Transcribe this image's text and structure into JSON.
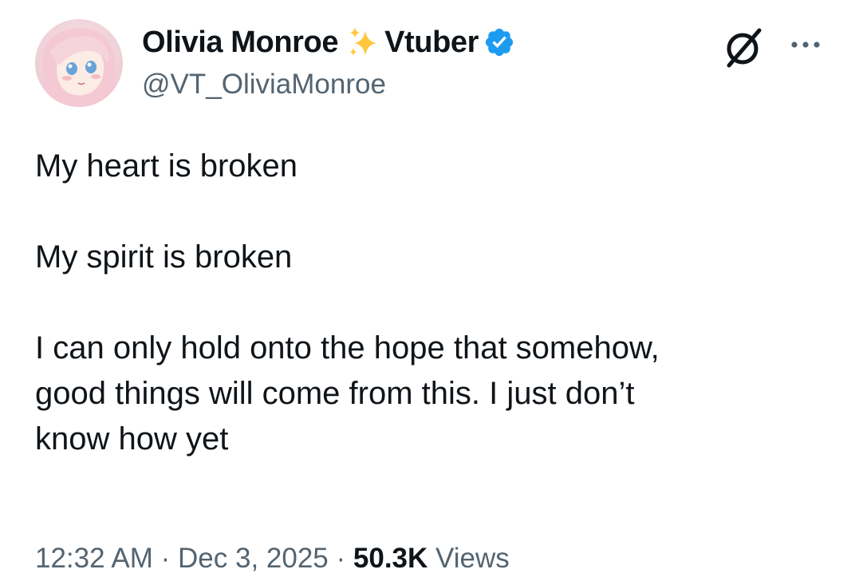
{
  "author": {
    "display_name": "Olivia Monroe",
    "name_emoji": "sparkles-icon",
    "name_suffix": "Vtuber",
    "verified": true,
    "handle": "@VT_OliviaMonroe"
  },
  "tweet": {
    "paragraphs": [
      [
        "My heart is broken"
      ],
      [
        "My spirit is broken"
      ],
      [
        "I can only hold onto the hope that somehow,",
        "good things will come from this. I just don’t",
        "know how yet"
      ]
    ]
  },
  "meta": {
    "time": "12:32 AM",
    "separator": "·",
    "date": "Dec 3, 2025",
    "views_count": "50.3K",
    "views_label": "Views"
  },
  "colors": {
    "text": "#0f1419",
    "secondary": "#536471",
    "verified": "#1d9bf0",
    "sparkle": "#ffc83d"
  }
}
